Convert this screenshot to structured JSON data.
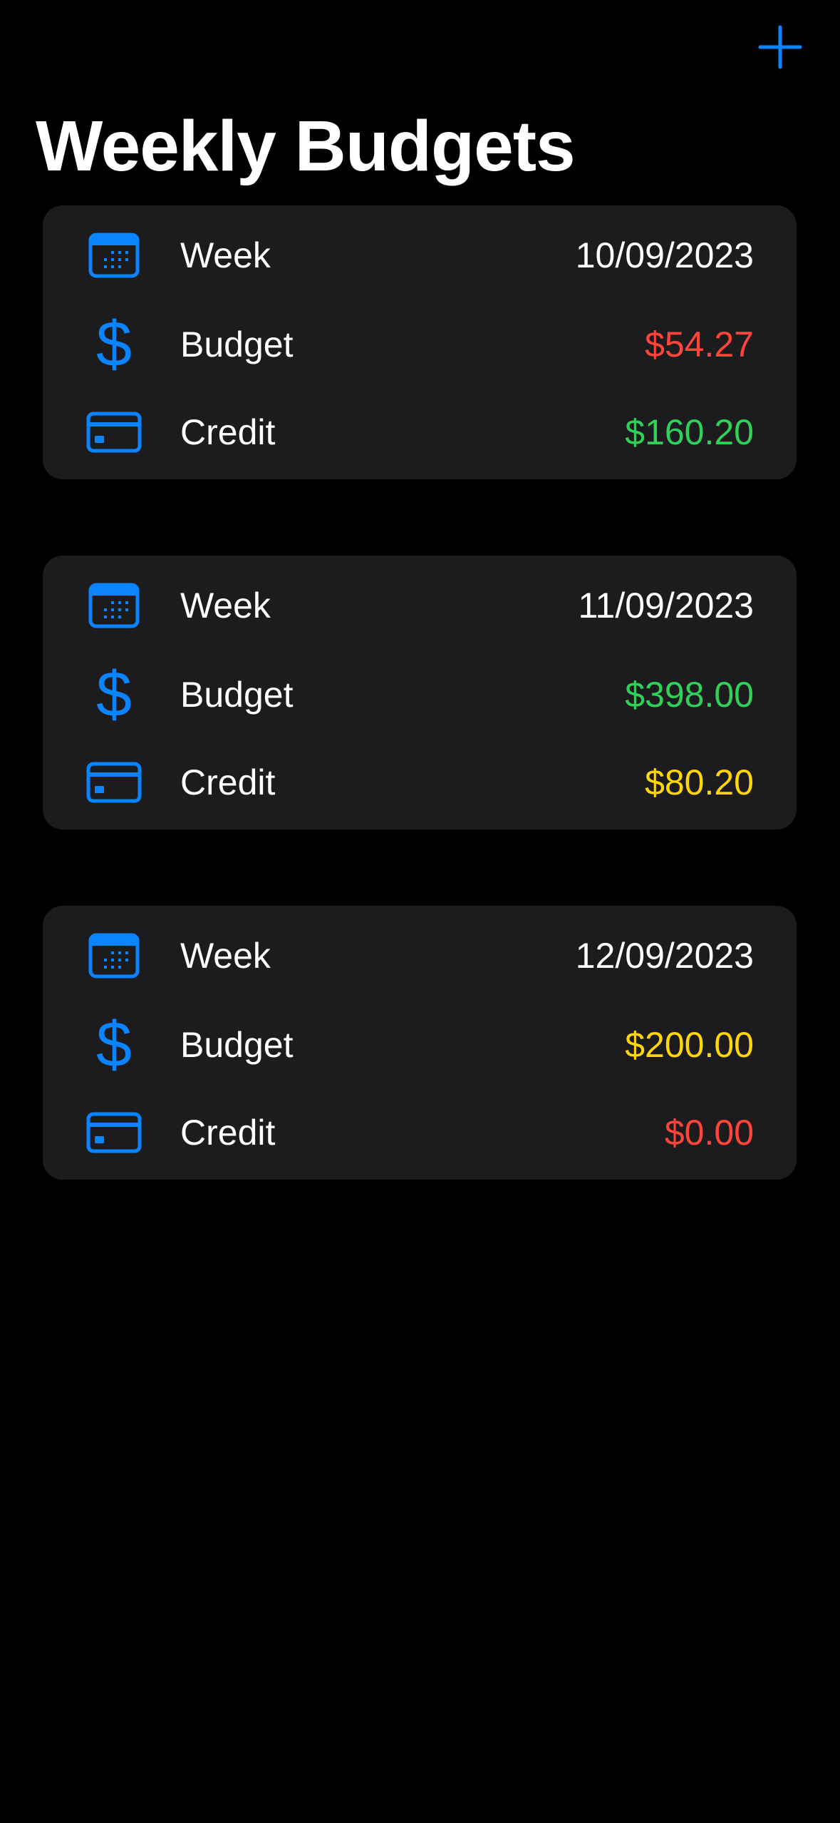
{
  "header": {
    "title": "Weekly Budgets",
    "add_icon": "plus-icon"
  },
  "colors": {
    "background": "#000000",
    "card": "#1c1c1e",
    "accent": "#0a84ff",
    "red": "#ff453a",
    "green": "#30d158",
    "yellow": "#ffd60a",
    "text": "#ffffff"
  },
  "budgets": [
    {
      "week_label": "Week",
      "week_icon": "calendar-icon",
      "week_value": "10/09/2023",
      "budget_label": "Budget",
      "budget_icon": "dollar-sign-icon",
      "budget_value": "$54.27",
      "budget_color": "#ff453a",
      "credit_label": "Credit",
      "credit_icon": "credit-card-icon",
      "credit_value": "$160.20",
      "credit_color": "#30d158"
    },
    {
      "week_label": "Week",
      "week_icon": "calendar-icon",
      "week_value": "11/09/2023",
      "budget_label": "Budget",
      "budget_icon": "dollar-sign-icon",
      "budget_value": "$398.00",
      "budget_color": "#30d158",
      "credit_label": "Credit",
      "credit_icon": "credit-card-icon",
      "credit_value": "$80.20",
      "credit_color": "#ffd60a"
    },
    {
      "week_label": "Week",
      "week_icon": "calendar-icon",
      "week_value": "12/09/2023",
      "budget_label": "Budget",
      "budget_icon": "dollar-sign-icon",
      "budget_value": "$200.00",
      "budget_color": "#ffd60a",
      "credit_label": "Credit",
      "credit_icon": "credit-card-icon",
      "credit_value": "$0.00",
      "credit_color": "#ff453a"
    }
  ]
}
